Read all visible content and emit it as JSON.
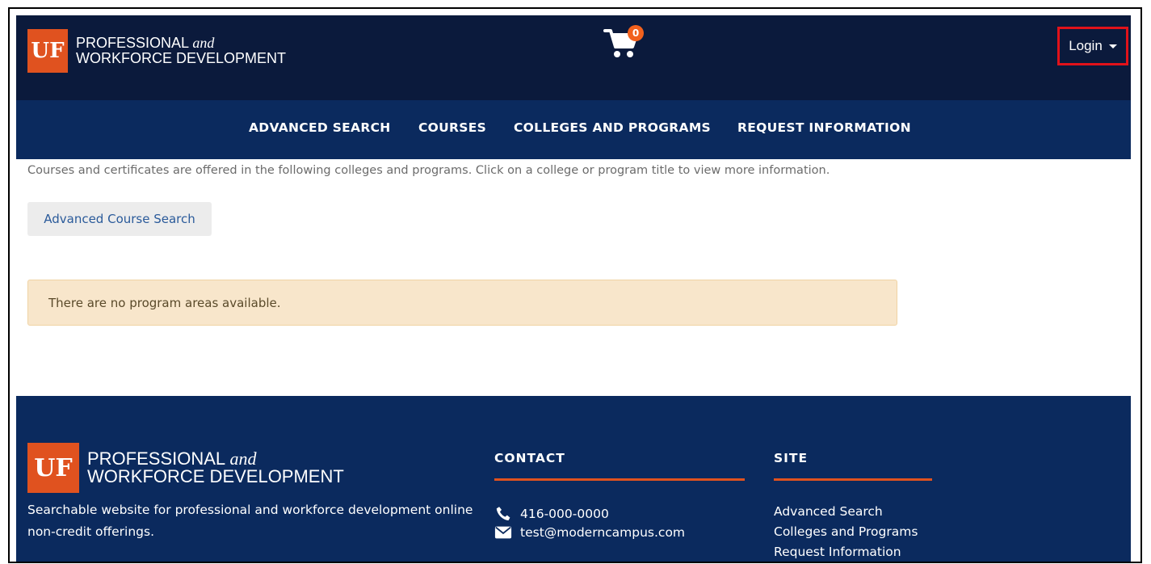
{
  "header": {
    "logo": {
      "badge": "UF",
      "line1": "PROFESSIONAL",
      "line1_italic": "and",
      "line2": "WORKFORCE DEVELOPMENT"
    },
    "cart": {
      "icon": "cart-icon",
      "count": "0"
    },
    "login": {
      "label": "Login",
      "icon": "caret-down-icon"
    }
  },
  "nav": {
    "items": [
      {
        "label": "ADVANCED SEARCH"
      },
      {
        "label": "COURSES"
      },
      {
        "label": "COLLEGES AND PROGRAMS"
      },
      {
        "label": "REQUEST INFORMATION"
      }
    ]
  },
  "main": {
    "intro": "Courses and certificates are offered in the following colleges and programs. Click on a college or program title to view more information.",
    "advanced_button": "Advanced Course Search",
    "alert": "There are no program areas available."
  },
  "footer": {
    "logo": {
      "badge": "UF",
      "line1": "PROFESSIONAL",
      "line1_italic": "and",
      "line2": "WORKFORCE DEVELOPMENT"
    },
    "description": "Searchable website for professional and workforce development online non-credit offerings.",
    "contact": {
      "title": "CONTACT",
      "phone": "416-000-0000",
      "email": "test@moderncampus.com",
      "phone_icon": "phone-icon",
      "email_icon": "envelope-icon"
    },
    "site": {
      "title": "SITE",
      "links": [
        "Advanced Search",
        "Colleges and Programs",
        "Request Information"
      ]
    }
  },
  "colors": {
    "header_bg": "#0b1a3c",
    "nav_bg": "#0b2a5e",
    "accent": "#e0521f",
    "login_highlight": "#e1121a"
  }
}
